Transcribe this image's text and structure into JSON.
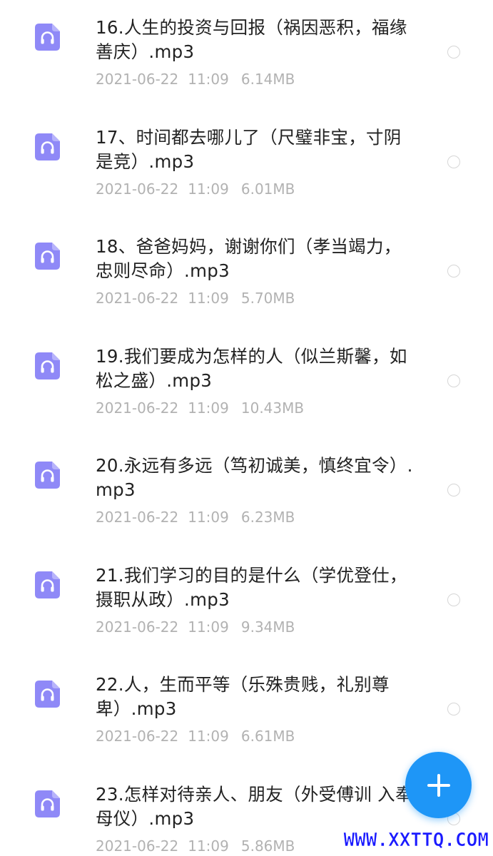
{
  "files": [
    {
      "name": "16.人生的投资与回报（祸因恶积，福缘善庆）.mp3",
      "date": "2021-06-22",
      "time": "11:09",
      "size": "6.14MB",
      "icon": "audio-file-icon"
    },
    {
      "name": "17、时间都去哪儿了（尺璧非宝，寸阴是竞）.mp3",
      "date": "2021-06-22",
      "time": "11:09",
      "size": "6.01MB",
      "icon": "audio-file-icon"
    },
    {
      "name": "18、爸爸妈妈，谢谢你们（孝当竭力，忠则尽命）.mp3",
      "date": "2021-06-22",
      "time": "11:09",
      "size": "5.70MB",
      "icon": "audio-file-icon"
    },
    {
      "name": "19.我们要成为怎样的人（似兰斯馨，如松之盛）.mp3",
      "date": "2021-06-22",
      "time": "11:09",
      "size": "10.43MB",
      "icon": "audio-file-icon"
    },
    {
      "name": "20.永远有多远（笃初诚美，慎终宜令）.mp3",
      "date": "2021-06-22",
      "time": "11:09",
      "size": "6.23MB",
      "icon": "audio-file-icon"
    },
    {
      "name": "21.我们学习的目的是什么（学优登仕，摄职从政）.mp3",
      "date": "2021-06-22",
      "time": "11:09",
      "size": "9.34MB",
      "icon": "audio-file-icon"
    },
    {
      "name": "22.人，生而平等（乐殊贵贱，礼别尊卑）.mp3",
      "date": "2021-06-22",
      "time": "11:09",
      "size": "6.61MB",
      "icon": "audio-file-icon"
    },
    {
      "name": "23.怎样对待亲人、朋友（外受傅训 入奉母仪）.mp3",
      "date": "2021-06-22",
      "time": "11:09",
      "size": "5.86MB",
      "icon": "audio-file-icon"
    }
  ],
  "fab": {
    "icon": "plus-icon",
    "color": "#1e96f7"
  },
  "watermark": {
    "text": "WWW.XXTTQ.COM",
    "color": "#1a1aff"
  },
  "colors": {
    "icon_bg": "#8f89f7",
    "name_text": "#222222",
    "meta_text": "#b2b2b2"
  }
}
